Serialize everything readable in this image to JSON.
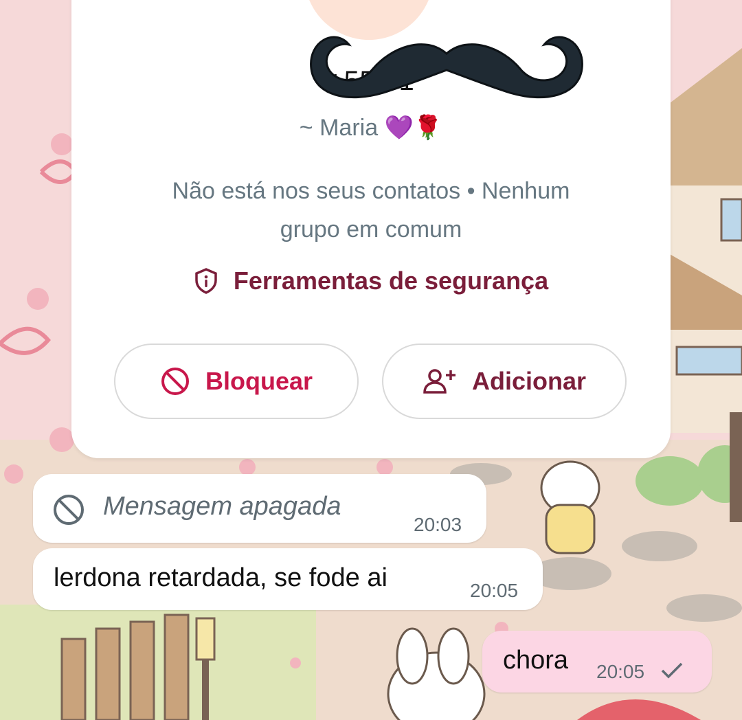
{
  "contact": {
    "phone": "+55 61",
    "pushname": "~ Maria 💜🌹",
    "info_line1": "Não está nos seus contatos • Nenhum",
    "info_line2": "grupo em comum",
    "safety_tools": "Ferramentas de segurança"
  },
  "actions": {
    "block_label": "Bloquear",
    "add_label": "Adicionar"
  },
  "messages": [
    {
      "text": "Mensagem apagada",
      "time": "20:03",
      "direction": "incoming",
      "deleted": true
    },
    {
      "text": "lerdona retardada, se fode ai",
      "time": "20:05",
      "direction": "incoming",
      "deleted": false
    },
    {
      "text": "chora",
      "time": "20:05",
      "direction": "outgoing",
      "status": "sent"
    }
  ],
  "icons": {
    "block": "block-icon",
    "add_person": "person-add-icon",
    "shield": "shield-info-icon",
    "deleted": "deleted-icon",
    "check": "check-icon"
  },
  "colors": {
    "accent_dark": "#7a1e3a",
    "block_red": "#c8174b",
    "outgoing_bubble": "#fcd6e4",
    "muted_text": "#667781"
  }
}
